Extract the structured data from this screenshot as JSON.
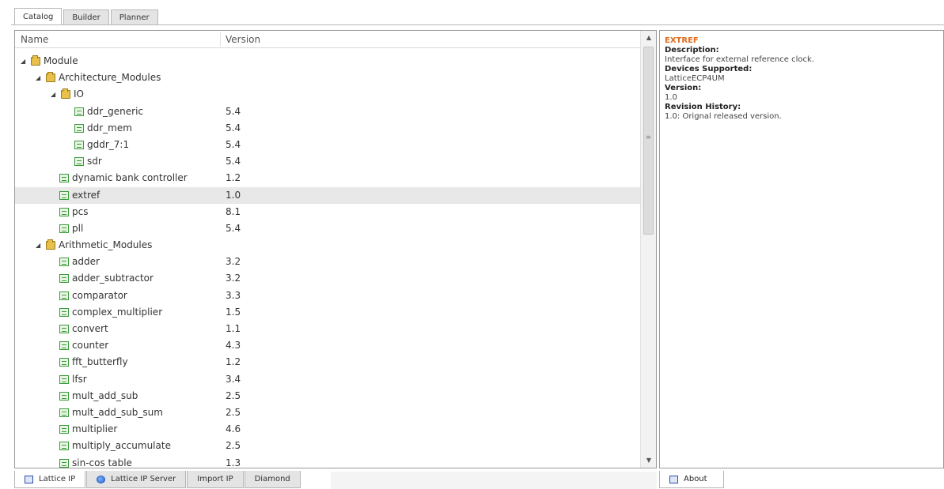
{
  "top_tabs": [
    "Catalog",
    "Builder",
    "Planner"
  ],
  "tree": {
    "columns": {
      "name": "Name",
      "version": "Version"
    },
    "rows": [
      {
        "label": "Module",
        "version": "",
        "level": 0,
        "type": "folder",
        "expanded": true
      },
      {
        "label": "Architecture_Modules",
        "version": "",
        "level": 1,
        "type": "folder",
        "expanded": true
      },
      {
        "label": "IO",
        "version": "",
        "level": 2,
        "type": "folder",
        "expanded": true
      },
      {
        "label": "ddr_generic",
        "version": "5.4",
        "level": 3,
        "type": "ip"
      },
      {
        "label": "ddr_mem",
        "version": "5.4",
        "level": 3,
        "type": "ip"
      },
      {
        "label": "gddr_7:1",
        "version": "5.4",
        "level": 3,
        "type": "ip"
      },
      {
        "label": "sdr",
        "version": "5.4",
        "level": 3,
        "type": "ip"
      },
      {
        "label": "dynamic bank controller",
        "version": "1.2",
        "level": 2,
        "type": "ip"
      },
      {
        "label": "extref",
        "version": "1.0",
        "level": 2,
        "type": "ip",
        "selected": true
      },
      {
        "label": "pcs",
        "version": "8.1",
        "level": 2,
        "type": "ip"
      },
      {
        "label": "pll",
        "version": "5.4",
        "level": 2,
        "type": "ip"
      },
      {
        "label": "Arithmetic_Modules",
        "version": "",
        "level": 1,
        "type": "folder",
        "expanded": true
      },
      {
        "label": "adder",
        "version": "3.2",
        "level": 2,
        "type": "ip"
      },
      {
        "label": "adder_subtractor",
        "version": "3.2",
        "level": 2,
        "type": "ip"
      },
      {
        "label": "comparator",
        "version": "3.3",
        "level": 2,
        "type": "ip"
      },
      {
        "label": "complex_multiplier",
        "version": "1.5",
        "level": 2,
        "type": "ip"
      },
      {
        "label": "convert",
        "version": "1.1",
        "level": 2,
        "type": "ip"
      },
      {
        "label": "counter",
        "version": "4.3",
        "level": 2,
        "type": "ip"
      },
      {
        "label": "fft_butterfly",
        "version": "1.2",
        "level": 2,
        "type": "ip"
      },
      {
        "label": "lfsr",
        "version": "3.4",
        "level": 2,
        "type": "ip"
      },
      {
        "label": "mult_add_sub",
        "version": "2.5",
        "level": 2,
        "type": "ip"
      },
      {
        "label": "mult_add_sub_sum",
        "version": "2.5",
        "level": 2,
        "type": "ip"
      },
      {
        "label": "multiplier",
        "version": "4.6",
        "level": 2,
        "type": "ip"
      },
      {
        "label": "multiply_accumulate",
        "version": "2.5",
        "level": 2,
        "type": "ip"
      },
      {
        "label": "sin-cos table",
        "version": "1.3",
        "level": 2,
        "type": "ip"
      }
    ]
  },
  "description": {
    "title": "EXTREF",
    "description_label": "Description:",
    "description_value": "Interface for external reference clock.",
    "devices_label": "Devices Supported:",
    "devices_value": "LatticeECP4UM",
    "version_label": "Version:",
    "version_value": "1.0",
    "history_label": "Revision History:",
    "history_value": "1.0: Orignal released version."
  },
  "bottom_tabs": [
    "Lattice IP",
    "Lattice IP Server",
    "Import IP",
    "Diamond"
  ],
  "about_tab": "About",
  "colors": {
    "accent_title": "#e06b1c",
    "folder": "#e8c04a",
    "ip_chip": "#3a9a3a"
  }
}
